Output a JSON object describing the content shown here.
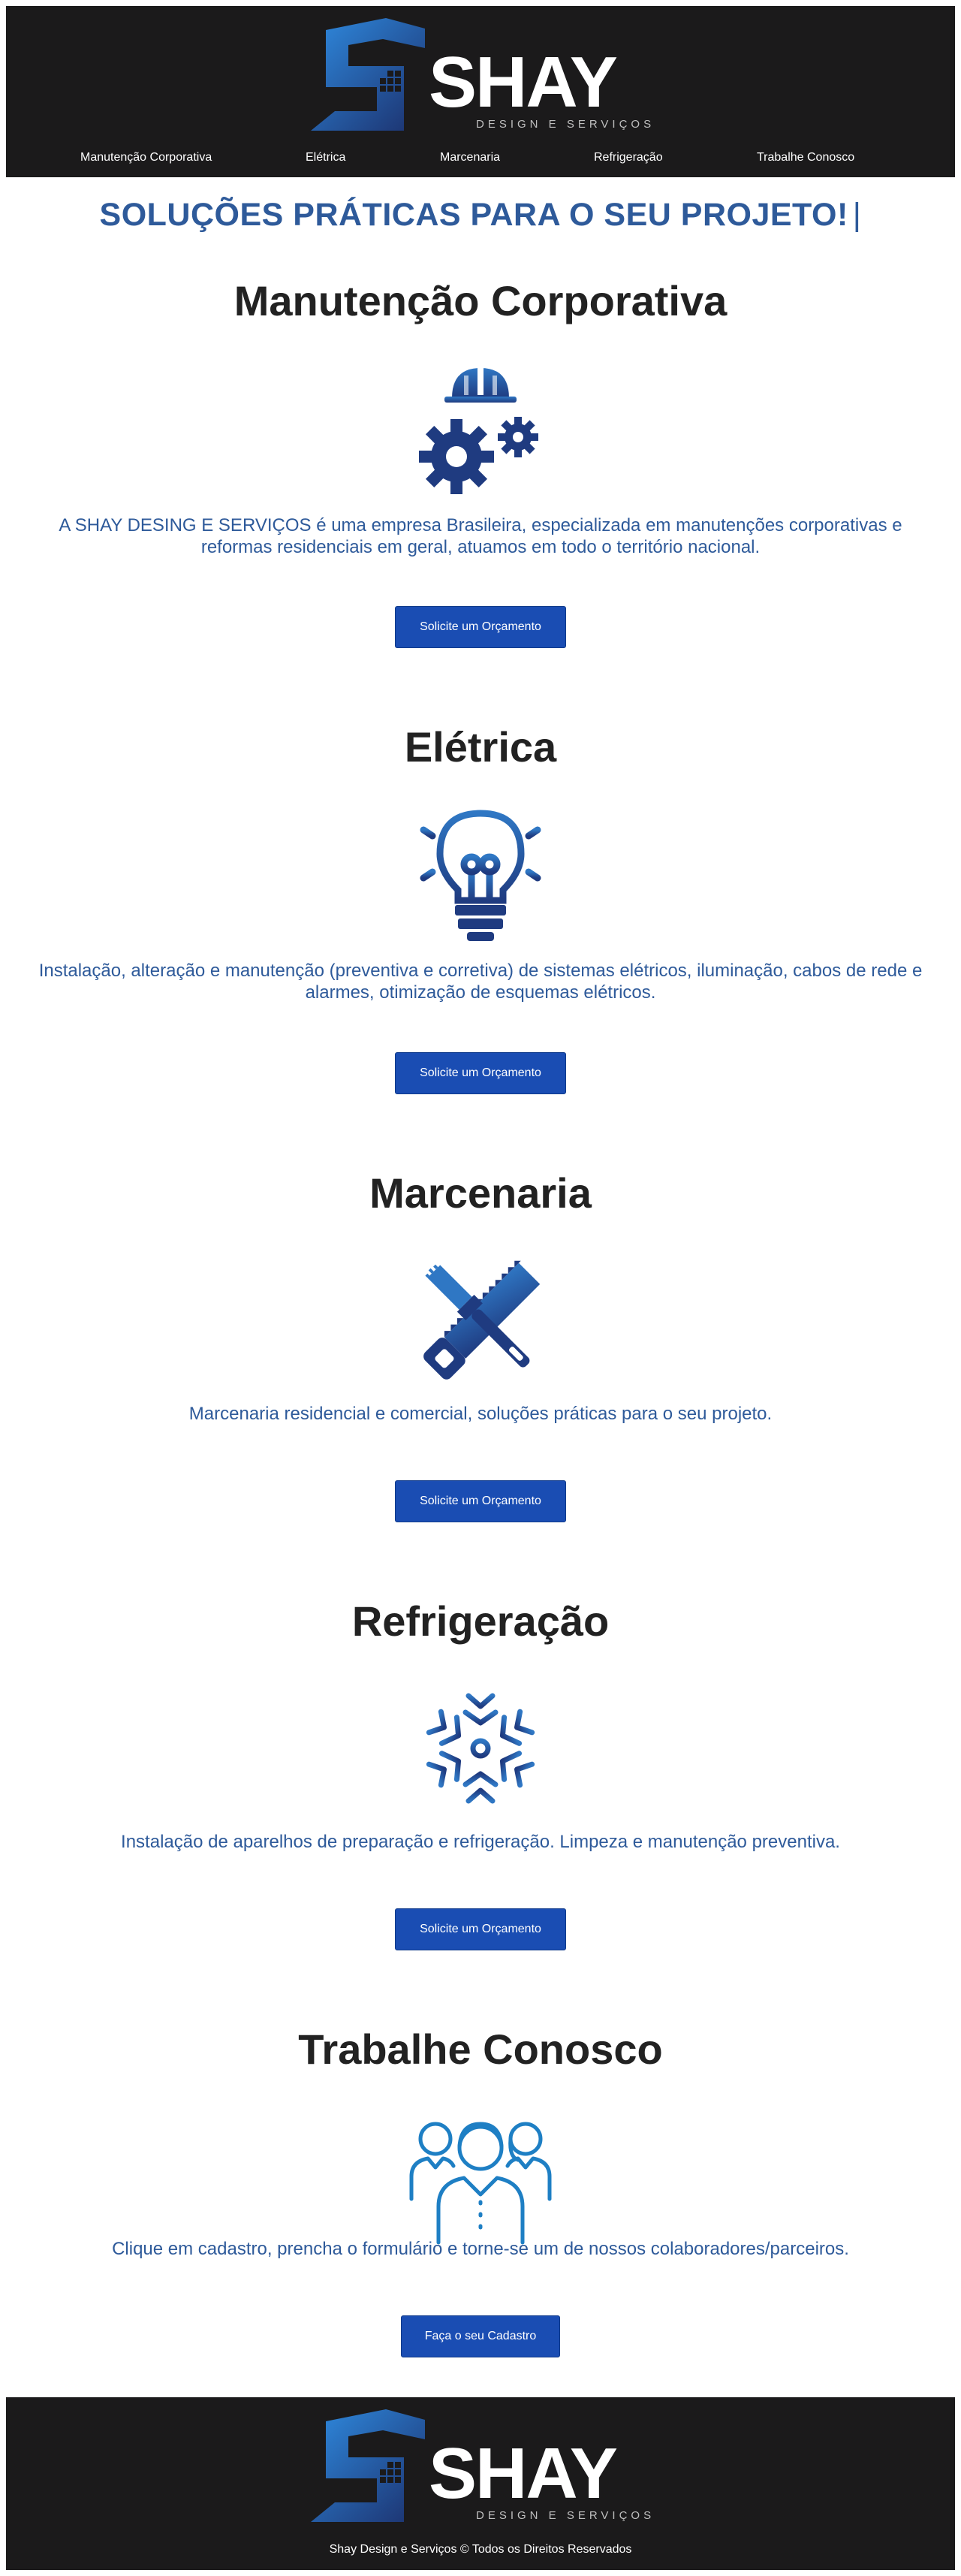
{
  "brand": {
    "name": "SHAY",
    "subtitle": "DESIGN E SERVIÇOS",
    "colors": {
      "dark": "#1b1a1b",
      "blue": "#2e5a9a",
      "button": "#1a4db3",
      "logo_blue_light": "#2f8be0",
      "logo_blue_dark": "#1c2f6b"
    }
  },
  "nav": {
    "items": [
      {
        "label": "Manutenção Corporativa"
      },
      {
        "label": "Elétrica"
      },
      {
        "label": "Marcenaria"
      },
      {
        "label": "Refrigeração"
      },
      {
        "label": "Trabalhe Conosco"
      }
    ]
  },
  "hero": {
    "tagline": "SOLUÇÕES PRÁTICAS PARA O SEU PROJETO!",
    "cursor": "|"
  },
  "sections": [
    {
      "title": "Manutenção Corporativa",
      "icon": "helmet-gears-icon",
      "description": "A SHAY DESING E SERVIÇOS é uma empresa Brasileira, especializada em manutenções corporativas e reformas residenciais em geral, atuamos em todo o território nacional.",
      "button": "Solicite um Orçamento"
    },
    {
      "title": "Elétrica",
      "icon": "lightbulb-icon",
      "description": "Instalação, alteração e manutenção (preventiva e corretiva) de sistemas elétricos, iluminação, cabos de rede e alarmes, otimização de esquemas elétricos.",
      "button": "Solicite um Orçamento"
    },
    {
      "title": "Marcenaria",
      "icon": "saw-brush-icon",
      "description": "Marcenaria residencial e comercial, soluções práticas para o seu projeto.",
      "button": "Solicite um Orçamento"
    },
    {
      "title": "Refrigeração",
      "icon": "snowflake-icon",
      "description": "Instalação de aparelhos de preparação e refrigeração. Limpeza e manutenção preventiva.",
      "button": "Solicite um Orçamento"
    },
    {
      "title": "Trabalhe Conosco",
      "icon": "team-people-icon",
      "description": "Clique em cadastro, prencha o formulário e torne-se um de nossos colaboradores/parceiros.",
      "button": "Faça o seu Cadastro"
    }
  ],
  "footer": {
    "copyright": "Shay Design e Serviços © Todos os Direitos Reservados"
  }
}
